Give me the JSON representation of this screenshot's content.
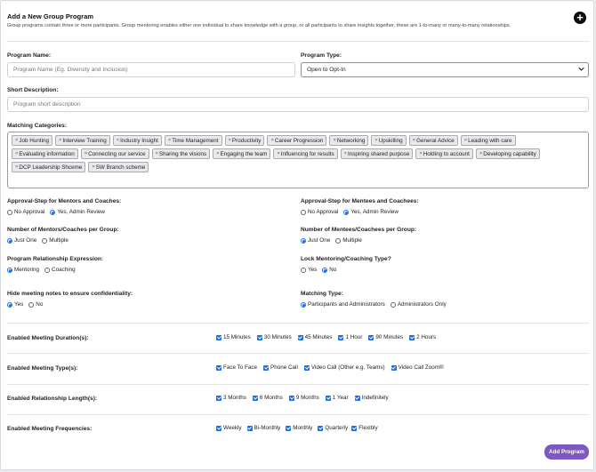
{
  "header": {
    "title": "Add a New Group Program",
    "description": "Group programs contain three or more participants. Group mentoring enables either one individual to share knowledge with a group, or all participants to share insights together, these are 1-to-many or many-to-many relationships."
  },
  "program_name": {
    "label": "Program Name:",
    "placeholder": "Program Name (Eg. Diversity and Inclusion)"
  },
  "program_type": {
    "label": "Program Type:",
    "value": "Open to Opt-In"
  },
  "short_description": {
    "label": "Short Description:",
    "placeholder": "Program short description"
  },
  "matching_categories": {
    "label": "Matching Categories:",
    "tags": [
      "Job Hunting",
      "Interview Training",
      "Industry Insight",
      "Time Management",
      "Productivity",
      "Career Progression",
      "Networking",
      "Upskilling",
      "General Advice",
      "Leading with care",
      "Evaluating information",
      "Connecting our service",
      "Sharing the visions",
      "Engaging the team",
      "Influencing for results",
      "Inspiring shared purpose",
      "Holding to account",
      "Developing capability",
      "DCP Leadership Shceme",
      "SW Branch scheme"
    ]
  },
  "approval_mentors": {
    "label": "Approval-Step for Mentors and Coaches:",
    "options": [
      "No Approval",
      "Yes, Admin Review"
    ],
    "selected": 1
  },
  "approval_mentees": {
    "label": "Approval-Step for Mentees and Coachees:",
    "options": [
      "No Approval",
      "Yes, Admin Review"
    ],
    "selected": 1
  },
  "num_mentors": {
    "label": "Number of Mentors/Coaches per Group:",
    "options": [
      "Just One",
      "Multiple"
    ],
    "selected": 0
  },
  "num_mentees": {
    "label": "Number of Mentees/Coachees per Group:",
    "options": [
      "Just One",
      "Multiple"
    ],
    "selected": 0
  },
  "relationship_expression": {
    "label": "Program Relationship Expression:",
    "options": [
      "Mentoring",
      "Coaching"
    ],
    "selected": 0
  },
  "lock_type": {
    "label": "Lock Mentoring/Coaching Type?",
    "options": [
      "Yes",
      "No"
    ],
    "selected": 1
  },
  "hide_notes": {
    "label": "Hide meeting notes to ensure confidentiality:",
    "options": [
      "Yes",
      "No"
    ],
    "selected": 0
  },
  "matching_type": {
    "label": "Matching Type:",
    "options": [
      "Participants and Administrators",
      "Administrators Only"
    ],
    "selected": 0
  },
  "meeting_durations": {
    "label": "Enabled Meeting Duration(s):",
    "options": [
      "15 Minutes",
      "30 Minutes",
      "45 Minutes",
      "1 Hour",
      "90 Minutes",
      "2 Hours"
    ]
  },
  "meeting_types": {
    "label": "Enabled Meeting Type(s):",
    "options": [
      "Face To Face",
      "Phone Call",
      "Video Call (Other e.g. Teams)",
      "Video Call Zoom®"
    ]
  },
  "relationship_lengths": {
    "label": "Enabled Relationship Length(s):",
    "options": [
      "3 Months",
      "6 Months",
      "9 Months",
      "1 Year",
      "Indefinitely"
    ]
  },
  "meeting_frequencies": {
    "label": "Enabled Meeting Frequencies:",
    "options": [
      "Weekly",
      "Bi-Monthly",
      "Monthly",
      "Quarterly",
      "Flexibly"
    ]
  },
  "submit_label": "Add Program",
  "colors": {
    "accent": "#1a6fe0",
    "button": "#7e57c2"
  }
}
